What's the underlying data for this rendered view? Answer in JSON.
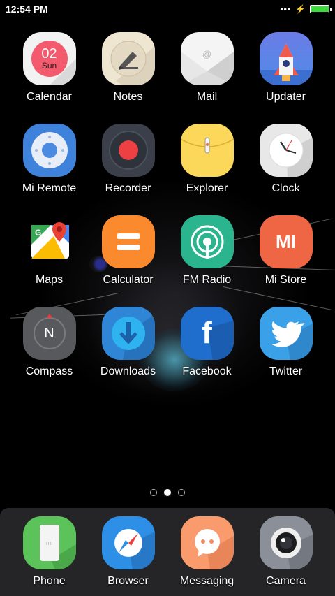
{
  "status": {
    "time": "12:54 PM",
    "signal_dots": "•••",
    "battery_level": 0.95,
    "battery_color": "#3ddc3d"
  },
  "apps": [
    {
      "label": "Calendar",
      "icon": "calendar-icon",
      "day_number": "02",
      "day_name": "Sun"
    },
    {
      "label": "Notes",
      "icon": "notes-icon"
    },
    {
      "label": "Mail",
      "icon": "mail-icon",
      "symbol": "@"
    },
    {
      "label": "Updater",
      "icon": "rocket-icon"
    },
    {
      "label": "Mi Remote",
      "icon": "remote-icon"
    },
    {
      "label": "Recorder",
      "icon": "recorder-icon"
    },
    {
      "label": "Explorer",
      "icon": "explorer-icon"
    },
    {
      "label": "Clock",
      "icon": "clock-icon"
    },
    {
      "label": "Maps",
      "icon": "maps-icon"
    },
    {
      "label": "Calculator",
      "icon": "calculator-icon",
      "symbol": "="
    },
    {
      "label": "FM Radio",
      "icon": "radio-icon"
    },
    {
      "label": "Mi Store",
      "icon": "mi-store-icon",
      "symbol": "MI"
    },
    {
      "label": "Compass",
      "icon": "compass-icon",
      "symbol": "N"
    },
    {
      "label": "Downloads",
      "icon": "downloads-icon"
    },
    {
      "label": "Facebook",
      "icon": "facebook-icon",
      "symbol": "f"
    },
    {
      "label": "Twitter",
      "icon": "twitter-icon"
    }
  ],
  "pager": {
    "page_count": 3,
    "current": 2
  },
  "dock": [
    {
      "label": "Phone",
      "icon": "phone-icon",
      "symbol": "mi"
    },
    {
      "label": "Browser",
      "icon": "browser-icon"
    },
    {
      "label": "Messaging",
      "icon": "messaging-icon"
    },
    {
      "label": "Camera",
      "icon": "camera-icon"
    }
  ]
}
